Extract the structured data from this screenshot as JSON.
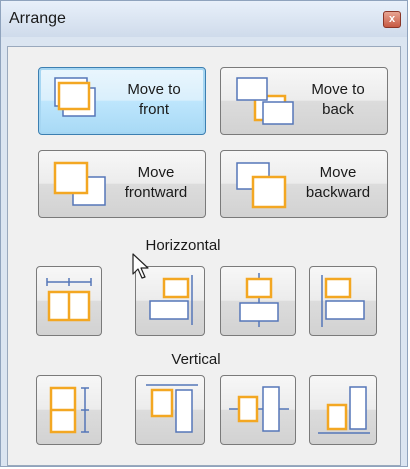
{
  "window": {
    "title": "Arrange",
    "close_glyph": "x"
  },
  "order_buttons": [
    {
      "label_line1": "Move to",
      "label_line2": "front",
      "icon": "bring-to-front-icon"
    },
    {
      "label_line1": "Move to",
      "label_line2": "back",
      "icon": "send-to-back-icon"
    },
    {
      "label_line1": "Move",
      "label_line2": "frontward",
      "icon": "bring-forward-icon"
    },
    {
      "label_line1": "Move",
      "label_line2": "backward",
      "icon": "send-backward-icon"
    }
  ],
  "sections": {
    "horizontal": "Horizzontal",
    "vertical": "Vertical"
  },
  "colors": {
    "accent_orange": "#f3a722",
    "accent_blue": "#5576b8",
    "focus_blue": "#3c7fb1"
  }
}
